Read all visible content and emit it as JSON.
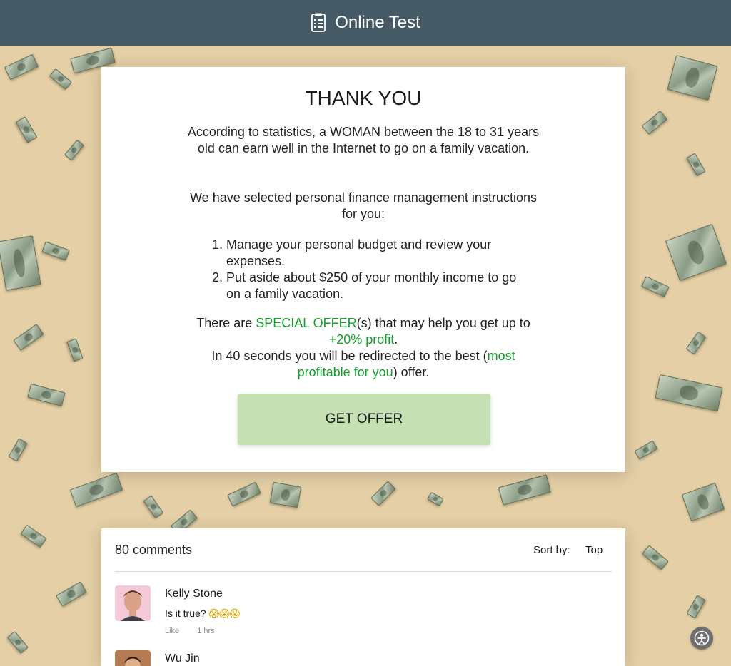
{
  "header": {
    "title": "Online Test",
    "icon": "document-list-icon",
    "bg_color": "#455a64"
  },
  "card": {
    "heading": "THANK YOU",
    "paragraph1": "According to statistics, a WOMAN between the 18 to 31 years old can earn well in the Internet to go on a family vacation.",
    "paragraph2": "We have selected personal finance management instructions for you:",
    "steps": [
      "Manage your personal budget and review your expenses.",
      "Put aside about $250 of your monthly income to go on a family vacation."
    ],
    "offer": {
      "pre": "There are ",
      "special": "SPECIAL OFFER",
      "mid": "(s) that may help you get up to ",
      "profit": "+20% profit",
      "dot": ".",
      "redirect_pre": "In 40 seconds you will be redirected to the best (",
      "redirect_highlight": "most profitable for you",
      "redirect_post": ") offer."
    },
    "button_label": "GET OFFER",
    "button_color": "#c5e1b4",
    "highlight_color": "#14a02c"
  },
  "comments": {
    "count_label": "80 comments",
    "sort_label": "Sort by:",
    "sort_value": "Top",
    "items": [
      {
        "name": "Kelly Stone",
        "text": "Is it true?",
        "emojis": "😱😱😱",
        "like_label": "Like",
        "time": "1 hrs"
      },
      {
        "name": "Wu Jin"
      }
    ]
  },
  "helper_icon": "accessibility-icon"
}
